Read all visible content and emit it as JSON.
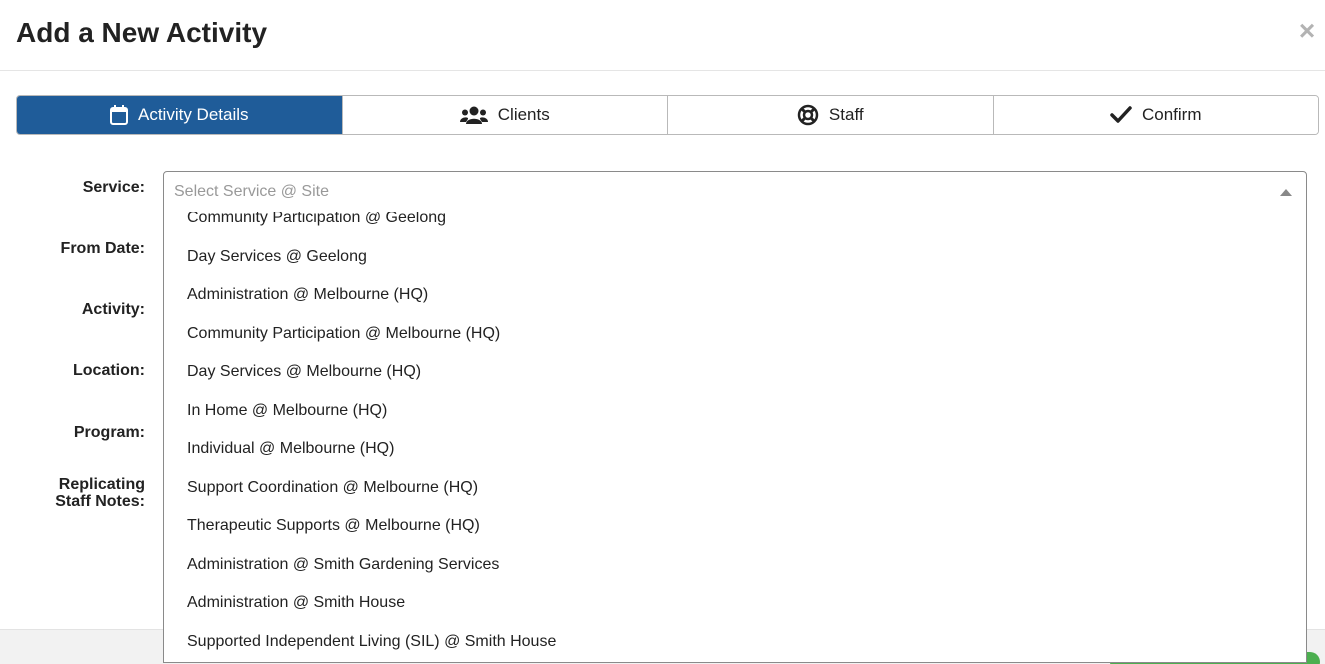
{
  "modal": {
    "title": "Add a New Activity",
    "close_label": "×"
  },
  "tabs": [
    {
      "label": "Activity Details",
      "icon": "calendar-icon",
      "active": true
    },
    {
      "label": "Clients",
      "icon": "users-icon",
      "active": false
    },
    {
      "label": "Staff",
      "icon": "life-ring-icon",
      "active": false
    },
    {
      "label": "Confirm",
      "icon": "check-icon",
      "active": false
    }
  ],
  "form": {
    "labels": {
      "service": "Service:",
      "from_date": "From Date:",
      "activity": "Activity:",
      "location": "Location:",
      "program": "Program:",
      "replicating_line1": "Replicating",
      "replicating_line2": "Staff Notes:"
    },
    "service_select": {
      "value": "",
      "placeholder": "Select Service @ Site",
      "options": [
        "Community Participation @ Geelong",
        "Day Services @ Geelong",
        "Administration @ Melbourne (HQ)",
        "Community Participation @ Melbourne (HQ)",
        "Day Services @ Melbourne (HQ)",
        "In Home @ Melbourne (HQ)",
        "Individual @ Melbourne (HQ)",
        "Support Coordination @ Melbourne (HQ)",
        "Therapeutic Supports @ Melbourne (HQ)",
        "Administration @ Smith Gardening Services",
        "Administration @ Smith House",
        "Supported Independent Living (SIL) @ Smith House"
      ]
    }
  },
  "colors": {
    "active_tab": "#1f5c99",
    "footer_button": "#4caf50"
  }
}
